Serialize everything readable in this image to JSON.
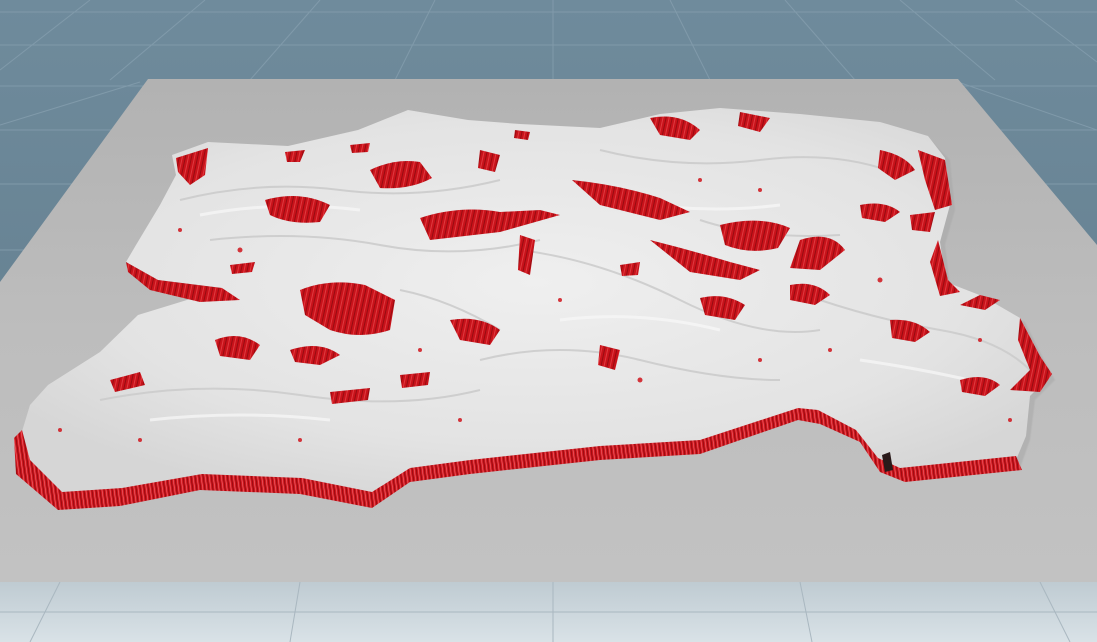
{
  "viewport": {
    "background_color": "#6b8798",
    "grid_color": "#89a2b2",
    "ground_plane_color": "#bcbcbc",
    "floor_color": "#cdd7dd",
    "terrain_base_color": "#e6e6e6",
    "terrain_shadow_color": "#c4c4c4",
    "terrain_highlight_color": "#f7f7f7",
    "slope_mask_color": "#d0141c",
    "slope_mask_dark_color": "#8f0a10",
    "axis_indicator_text": ""
  },
  "icons": {
    "axis_gizmo": "axis-gizmo-icon"
  }
}
